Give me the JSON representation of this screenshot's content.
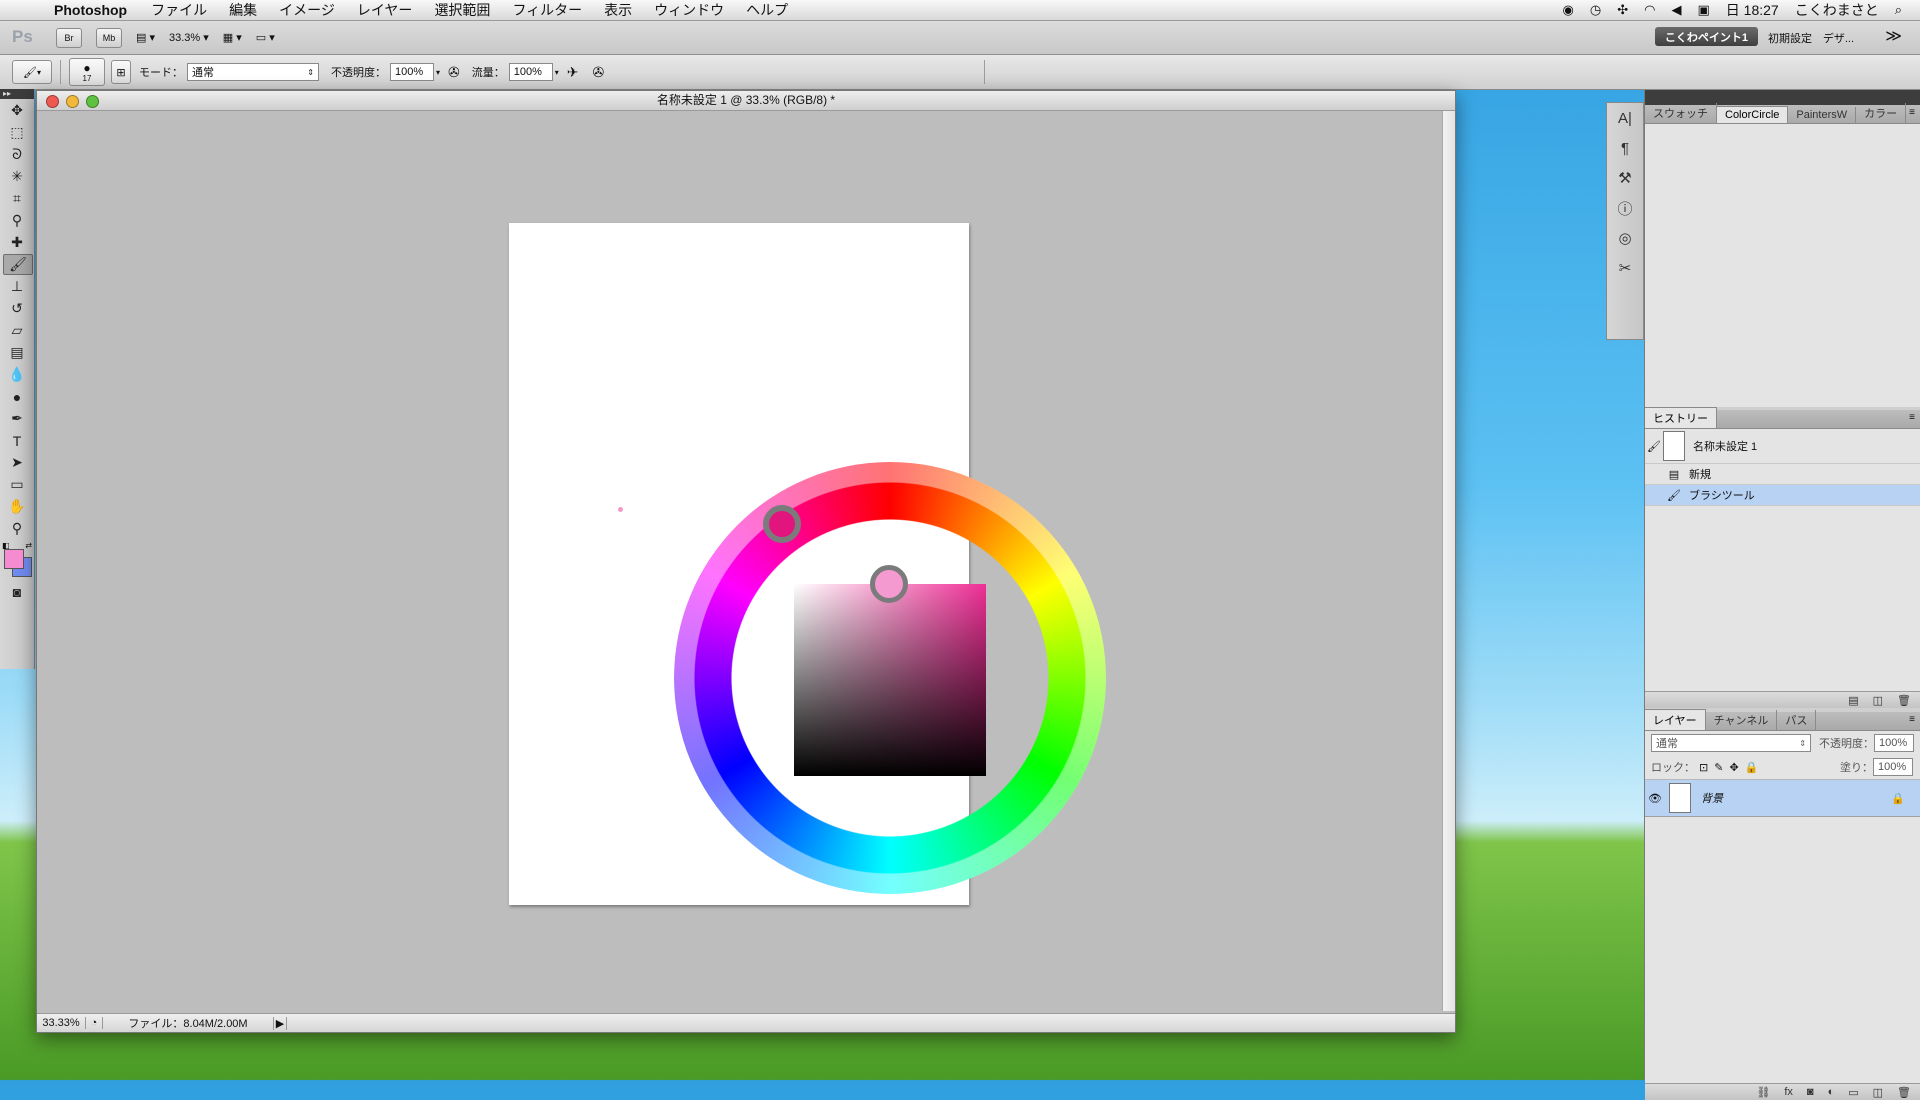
{
  "menubar": {
    "apple": "",
    "app_name": "Photoshop",
    "items": [
      "ファイル",
      "編集",
      "イメージ",
      "レイヤー",
      "選択範囲",
      "フィルター",
      "表示",
      "ウィンドウ",
      "ヘルプ"
    ],
    "clock": "日 18:27",
    "user": "こくわまさと"
  },
  "appbar": {
    "logo": "Ps",
    "bridge": "Br",
    "minibridge": "Mb",
    "zoom": "33.3%",
    "workspace_active": "こくわペイント1",
    "workspace_initial": "初期設定",
    "workspace_design": "デザ...",
    "more": "≫"
  },
  "options": {
    "brush_size": "17",
    "mode_label": "モード：",
    "mode_value": "通常",
    "opacity_label": "不透明度：",
    "opacity_value": "100%",
    "flow_label": "流量：",
    "flow_value": "100%"
  },
  "document": {
    "title": "名称未設定 1 @ 33.3% (RGB/8) *",
    "zoom": "33.33%",
    "file_info": "ファイル：8.04M/2.00M"
  },
  "color_circle": {
    "selected_hue_color": "#e2147e",
    "selected_color": "#f49ad0",
    "square_hue": "#ef2f96"
  },
  "colors": {
    "foreground": "#f58bd0",
    "background": "#6f8bf0"
  },
  "panels": {
    "swatch_tabs": [
      "スウォッチ",
      "ColorCircle",
      "PaintersW",
      "カラー"
    ],
    "history_tab": "ヒストリー",
    "history_snapshot": "名称未設定 1",
    "history_items": [
      "新規",
      "ブラシツール"
    ],
    "layers_tabs": [
      "レイヤー",
      "チャンネル",
      "パス"
    ],
    "blend_mode": "通常",
    "opacity_label": "不透明度：",
    "opacity_value": "100%",
    "lock_label": "ロック：",
    "fill_label": "塗り：",
    "fill_value": "100%",
    "layer_name": "背景"
  }
}
